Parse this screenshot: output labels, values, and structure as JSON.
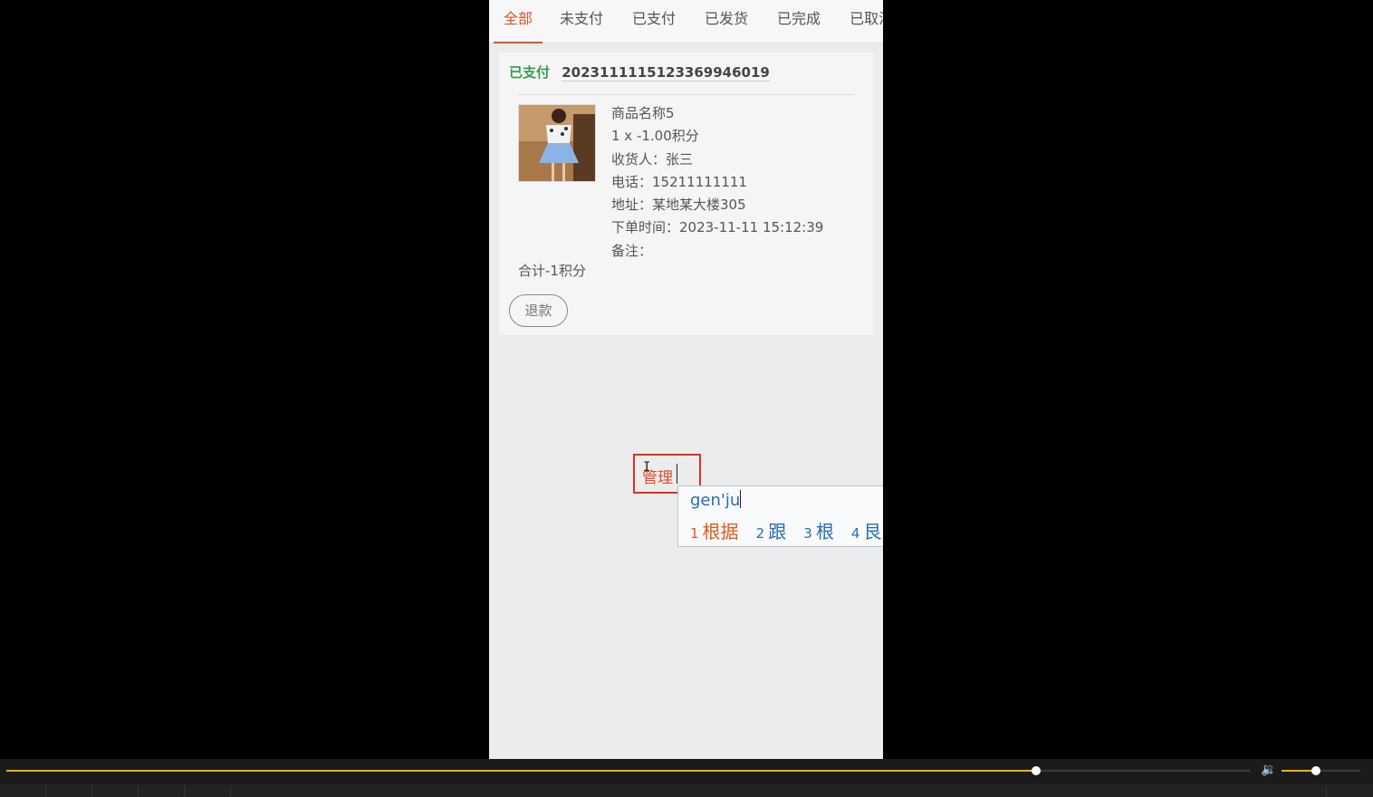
{
  "tabs": [
    {
      "label": "全部",
      "active": true
    },
    {
      "label": "未支付"
    },
    {
      "label": "已支付"
    },
    {
      "label": "已发货"
    },
    {
      "label": "已完成"
    },
    {
      "label": "已取消"
    }
  ],
  "order": {
    "status": "已支付",
    "order_no": "20231111151233699460​19",
    "product_name": "商品名称5",
    "qty_price": "1 x -1.00积分",
    "receiver": "收货人：张三",
    "phone": "电话：15211111111",
    "address": "地址：某地某大楼305",
    "order_time": "下单时间：2023-11-11 15:12:39",
    "remark": "备注：",
    "total": "合计-1积分",
    "refund_label": "退款"
  },
  "ime": {
    "composed_text": "管理",
    "pinyin": "gen'ju",
    "candidates": [
      {
        "index": "1",
        "text": "根据"
      },
      {
        "index": "2",
        "text": "跟"
      },
      {
        "index": "3",
        "text": "根"
      },
      {
        "index": "4",
        "text": "艮"
      }
    ]
  },
  "player": {
    "progress": 0.828,
    "volume": 0.44,
    "accent_color": "#e8b800"
  }
}
